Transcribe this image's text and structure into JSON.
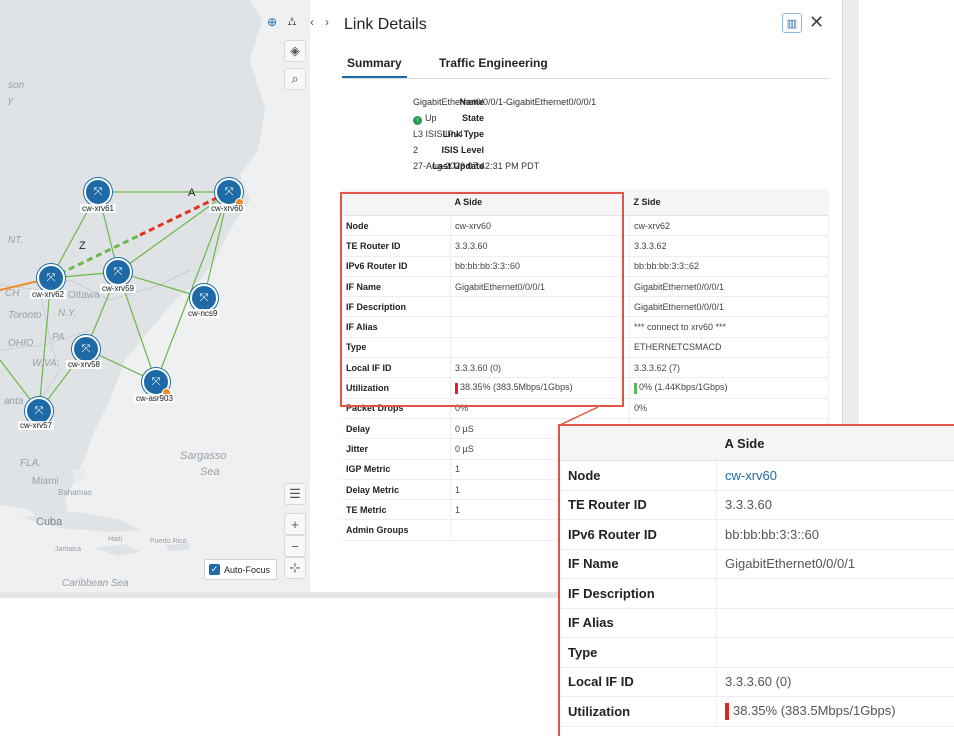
{
  "map": {
    "labels": {
      "son": "son",
      "y": "y",
      "nt": "NT.",
      "ch": "CH",
      "ottawa": "Ottawa",
      "toronto": "Toronto",
      "ny": "N.Y.",
      "pa": "PA",
      "ohio": "OHIO",
      "wva": "W.VA.",
      "anta": "anta",
      "sargasso": "Sargasso",
      "sea": "Sea",
      "miami": "Miami",
      "bahamas": "Bahamas",
      "cuba": "Cuba",
      "haiti": "Haiti",
      "jamaica": "Jamaica",
      "puerto_rico": "Puerto Rico",
      "caribbean": "Caribbean Sea",
      "fla": "FLA.",
      "link_a": "A",
      "link_z": "Z"
    },
    "nodes": [
      {
        "id": "cw-xrv61",
        "label": "cw-xrv61"
      },
      {
        "id": "cw-xrv60",
        "label": "cw-xrv60"
      },
      {
        "id": "cw-xrv62",
        "label": "cw-xrv62"
      },
      {
        "id": "cw-xrv59",
        "label": "cw-xrv59"
      },
      {
        "id": "cw-ncs9",
        "label": "cw-ncs9"
      },
      {
        "id": "cw-xrv58",
        "label": "cw-xrv58"
      },
      {
        "id": "cw-asr903",
        "label": "cw-asr903"
      },
      {
        "id": "cw-xrv57",
        "label": "cw-xrv57"
      }
    ],
    "auto_focus_label": "Auto-Focus",
    "auto_focus_checked": true,
    "icons": [
      "globe-icon",
      "topology-icon",
      "chevron-left-icon",
      "chevron-right-icon",
      "layers-icon",
      "search-icon",
      "list-icon",
      "zoom-in-icon",
      "zoom-out-icon",
      "fit-icon"
    ]
  },
  "panel": {
    "title": "Link Details",
    "tabs": [
      "Summary",
      "Traffic Engineering"
    ],
    "active_tab": "Summary",
    "summary": {
      "name_label": "Name",
      "name": "GigabitEthernet0/0/0/1-GigabitEthernet0/0/0/1",
      "state_label": "State",
      "state": "Up",
      "link_type_label": "Link Type",
      "link_type": "L3 ISIS IPv4",
      "isis_level_label": "ISIS Level",
      "isis_level": "2",
      "last_update_label": "Last Update",
      "last_update": "27-Aug-2023 07:42:31 PM PDT"
    },
    "table": {
      "headers": [
        "",
        "A Side",
        "Z Side"
      ],
      "rows": [
        {
          "label": "Node",
          "a": "cw-xrv60",
          "z": "cw-xrv62"
        },
        {
          "label": "TE Router ID",
          "a": "3.3.3.60",
          "z": "3.3.3.62"
        },
        {
          "label": "IPv6 Router ID",
          "a": "bb:bb:bb:3:3::60",
          "z": "bb:bb:bb:3:3::62"
        },
        {
          "label": "IF Name",
          "a": "GigabitEthernet0/0/0/1",
          "z": "GigabitEthernet0/0/0/1"
        },
        {
          "label": "IF Description",
          "a": "",
          "z": "GigabitEthernet0/0/0/1"
        },
        {
          "label": "IF Alias",
          "a": "",
          "z": "*** connect to xrv60 ***"
        },
        {
          "label": "Type",
          "a": "",
          "z": "ETHERNETCSMACD"
        },
        {
          "label": "Local IF ID",
          "a": "3.3.3.60 (0)",
          "z": "3.3.3.62 (7)"
        },
        {
          "label": "Utilization",
          "a": "38.35% (383.5Mbps/1Gbps)",
          "z": "0% (1.44Kbps/1Gbps)"
        },
        {
          "label": "Packet Drops",
          "a": "0%",
          "z": "0%"
        },
        {
          "label": "Delay",
          "a": "0 µS",
          "z": ""
        },
        {
          "label": "Jitter",
          "a": "0 µS",
          "z": ""
        },
        {
          "label": "IGP Metric",
          "a": "1",
          "z": ""
        },
        {
          "label": "Delay Metric",
          "a": "1",
          "z": ""
        },
        {
          "label": "TE Metric",
          "a": "1",
          "z": ""
        },
        {
          "label": "Admin Groups",
          "a": "",
          "z": ""
        }
      ],
      "utilization_a_pct": 38.35,
      "utilization_z_pct": 0
    }
  },
  "zoom": {
    "header": "A Side",
    "rows": [
      {
        "label": "Node",
        "value": "cw-xrv60"
      },
      {
        "label": "TE Router ID",
        "value": "3.3.3.60"
      },
      {
        "label": "IPv6 Router ID",
        "value": "bb:bb:bb:3:3::60"
      },
      {
        "label": "IF Name",
        "value": "GigabitEthernet0/0/0/1"
      },
      {
        "label": "IF Description",
        "value": ""
      },
      {
        "label": "IF Alias",
        "value": ""
      },
      {
        "label": "Type",
        "value": ""
      },
      {
        "label": "Local IF ID",
        "value": "3.3.3.60 (0)"
      },
      {
        "label": "Utilization",
        "value": "38.35% (383.5Mbps/1Gbps)"
      }
    ]
  },
  "colors": {
    "accent": "#1d6aa6",
    "link_red": "#e0321e",
    "link_green": "#6cb84a",
    "util_red": "#d9281c",
    "util_green": "#5cb85c",
    "highlight": "#e25544",
    "state_up": "#2b9a4a"
  }
}
